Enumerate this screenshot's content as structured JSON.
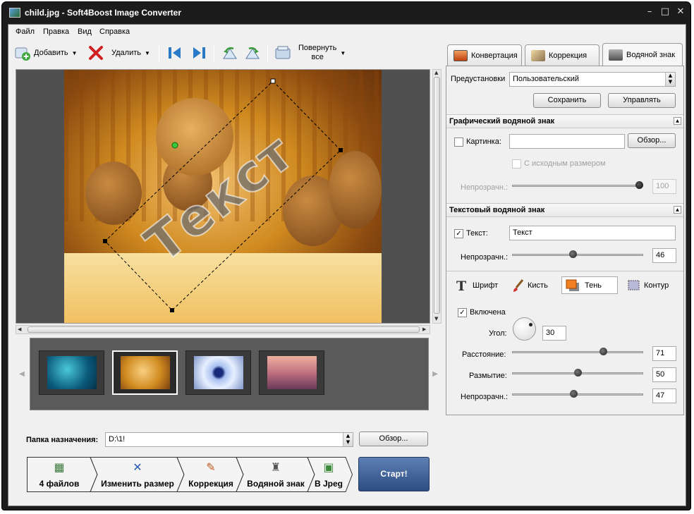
{
  "window": {
    "title": "child.jpg - Soft4Boost Image Converter"
  },
  "menu": [
    "Файл",
    "Правка",
    "Вид",
    "Справка"
  ],
  "toolbar": {
    "add_label": "Добавить",
    "remove_label": "Удалить",
    "rotate_all_label_line1": "Повернуть",
    "rotate_all_label_line2": "все"
  },
  "preview": {
    "watermark_text": "Текст"
  },
  "thumbnails": [
    {
      "name": "underwater",
      "selected": false,
      "colors": [
        "#1a8aa8",
        "#0a3a5a"
      ]
    },
    {
      "name": "child",
      "selected": true,
      "colors": [
        "#f0b050",
        "#8a4a10"
      ]
    },
    {
      "name": "eye",
      "selected": false,
      "colors": [
        "#c8d8ff",
        "#2a3a8a"
      ]
    },
    {
      "name": "fantasy",
      "selected": false,
      "colors": [
        "#e0a080",
        "#6a3a5a"
      ]
    }
  ],
  "destination": {
    "label": "Папка назначения:",
    "value": "D:\\1!",
    "browse_label": "Обзор..."
  },
  "steps": [
    {
      "label": "4 файлов",
      "icon": "calculator-icon",
      "glyph": "▦",
      "color": "#3a7a3a"
    },
    {
      "label": "Изменить размер",
      "icon": "resize-icon",
      "glyph": "✕",
      "color": "#2a5ab0"
    },
    {
      "label": "Коррекция",
      "icon": "correction-icon",
      "glyph": "✎",
      "color": "#c05a20"
    },
    {
      "label": "Водяной знак",
      "icon": "watermark-icon",
      "glyph": "♜",
      "color": "#555555"
    },
    {
      "label": "В Jpeg",
      "icon": "jpeg-icon",
      "glyph": "▣",
      "color": "#3a8a3a"
    }
  ],
  "start_label": "Старт!",
  "tabs": [
    {
      "label": "Конвертация",
      "active": false
    },
    {
      "label": "Коррекция",
      "active": false
    },
    {
      "label": "Водяной знак",
      "active": true
    }
  ],
  "presets": {
    "label": "Предустановки",
    "value": "Пользовательский",
    "save_label": "Сохранить",
    "manage_label": "Управлять"
  },
  "graphic_watermark": {
    "title": "Графический водяной знак",
    "picture_label": "Картинка:",
    "picture_checked": false,
    "picture_value": "",
    "browse_label": "Обзор...",
    "original_size_label": "С исходным размером",
    "opacity_label": "Непрозрачн.:",
    "opacity_value": "100",
    "opacity_fraction": 1.0
  },
  "text_watermark": {
    "title": "Текстовый водяной знак",
    "text_label": "Текст:",
    "text_checked": true,
    "text_value": "Текст",
    "opacity_label": "Непрозрачн.:",
    "opacity_value": "46",
    "opacity_fraction": 0.46
  },
  "style_tabs": [
    {
      "label": "Шрифт",
      "icon": "font-icon",
      "active": false
    },
    {
      "label": "Кисть",
      "icon": "brush-icon",
      "active": false
    },
    {
      "label": "Тень",
      "icon": "shadow-icon",
      "active": true
    },
    {
      "label": "Контур",
      "icon": "outline-icon",
      "active": false
    }
  ],
  "shadow": {
    "enabled_label": "Включена",
    "enabled": true,
    "angle_label": "Угол:",
    "angle_value": "30",
    "distance_label": "Расстояние:",
    "distance_value": "71",
    "distance_fraction": 0.71,
    "blur_label": "Размытие:",
    "blur_value": "50",
    "blur_fraction": 0.5,
    "opacity_label": "Непрозрачн.:",
    "opacity_value": "47",
    "opacity_fraction": 0.47
  }
}
